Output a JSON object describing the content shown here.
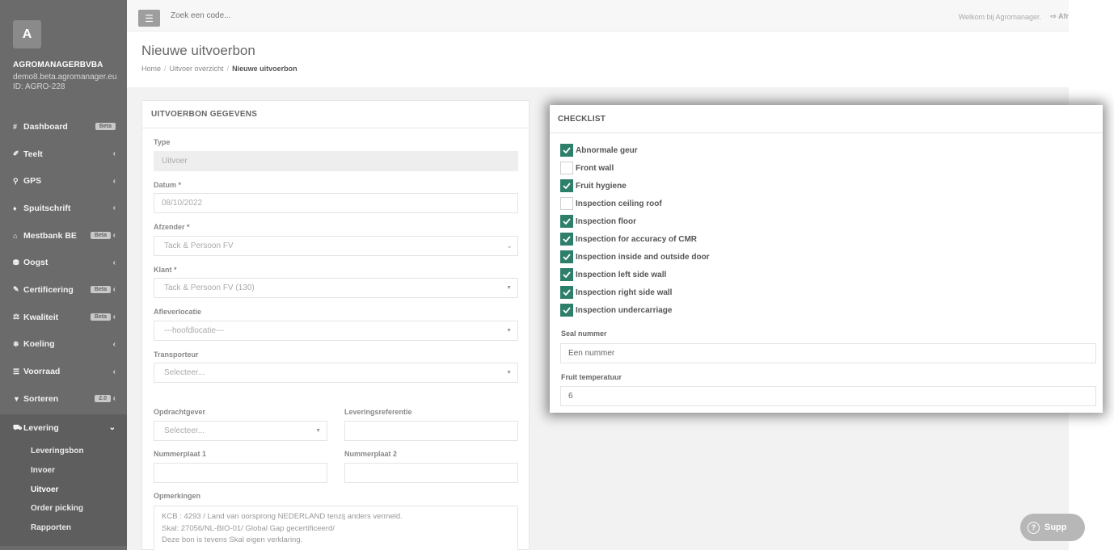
{
  "app": {
    "logo_letter": "A",
    "org_name": "AGROMANAGERBVBA",
    "org_domain": "demo8.beta.agromanager.eu",
    "org_id": "ID: AGRO-228"
  },
  "sidebar": {
    "items": [
      {
        "label": "Dashboard",
        "icon": "#",
        "badge": "Beta"
      },
      {
        "label": "Teelt",
        "icon": "✐"
      },
      {
        "label": "GPS",
        "icon": "⚲"
      },
      {
        "label": "Spuitschrift",
        "icon": "♦"
      },
      {
        "label": "Mestbank BE",
        "icon": "⌂",
        "badge": "Beta"
      },
      {
        "label": "Oogst",
        "icon": "⛃"
      },
      {
        "label": "Certificering",
        "icon": "✎",
        "badge": "Beta"
      },
      {
        "label": "Kwaliteit",
        "icon": "⚖",
        "badge": "Beta"
      },
      {
        "label": "Koeling",
        "icon": "❄"
      },
      {
        "label": "Voorraad",
        "icon": "☰"
      },
      {
        "label": "Sorteren",
        "icon": "▼",
        "badge": "2.0"
      },
      {
        "label": "Levering",
        "icon": "⛟"
      }
    ],
    "sub_items": [
      "Leveringsbon",
      "Invoer",
      "Uitvoer",
      "Order picking",
      "Rapporten"
    ],
    "current_sub": "Uitvoer"
  },
  "topbar": {
    "menu_icon": "☰",
    "search_placeholder": "Zoek een code...",
    "welcome": "Welkom bij Agromanager.",
    "logout": "⇨ Afr"
  },
  "header": {
    "title": "Nieuwe uitvoerbon",
    "breadcrumb": [
      "Home",
      "Uitvoer overzicht",
      "Nieuwe uitvoerbon"
    ],
    "separator": "/"
  },
  "form": {
    "title": "UITVOERBON GEGEVENS",
    "type_label": "Type",
    "type_value": "Uitvoer",
    "datum_label": "Datum *",
    "datum_value": "08/10/2022",
    "afzender_label": "Afzender *",
    "afzender_value": "Tack & Persoon FV",
    "klant_label": "Klant *",
    "klant_value": "Tack & Persoon FV (130)",
    "afleverlocatie_label": "Afleverlocatie",
    "afleverlocatie_value": "---hoofdlocatie---",
    "transporteur_label": "Transporteur",
    "transporteur_value": "Selecteer...",
    "opdrachtgever_label": "Opdrachtgever",
    "opdrachtgever_value": "Selecteer...",
    "leveringsreferentie_label": "Leveringsreferentie",
    "leveringsreferentie_value": "",
    "nummerplaat1_label": "Nummerplaat 1",
    "nummerplaat1_value": "",
    "nummerplaat2_label": "Nummerplaat 2",
    "nummerplaat2_value": "",
    "opmerkingen_label": "Opmerkingen",
    "opmerkingen_lines": [
      "KCB : 4293 / Land van oorsprong NEDERLAND tenzij anders vermeld.",
      "Skal: 27056/NL-BIO-01/ Global Gap gecertificeerd/",
      "Deze bon is tevens Skal eigen verklaring."
    ]
  },
  "checklist": {
    "title": "CHECKLIST",
    "items": [
      {
        "label": "Abnormale geur",
        "checked": true
      },
      {
        "label": "Front wall",
        "checked": false
      },
      {
        "label": "Fruit hygiene",
        "checked": true
      },
      {
        "label": "Inspection ceiling roof",
        "checked": false
      },
      {
        "label": "Inspection floor",
        "checked": true
      },
      {
        "label": "Inspection for accuracy of CMR",
        "checked": true
      },
      {
        "label": "Inspection inside and outside door",
        "checked": true
      },
      {
        "label": "Inspection left side wall",
        "checked": true
      },
      {
        "label": "Inspection right side wall",
        "checked": true
      },
      {
        "label": "Inspection undercarriage",
        "checked": true
      }
    ],
    "seal_label": "Seal nummer",
    "seal_value": "Een nummer",
    "temp_label": "Fruit temperatuur",
    "temp_value": "6"
  },
  "support": {
    "icon": "?",
    "label": "Supp"
  },
  "colors": {
    "sidebar_bg": "#6b6b6b",
    "check_green": "#2d7f6b"
  }
}
